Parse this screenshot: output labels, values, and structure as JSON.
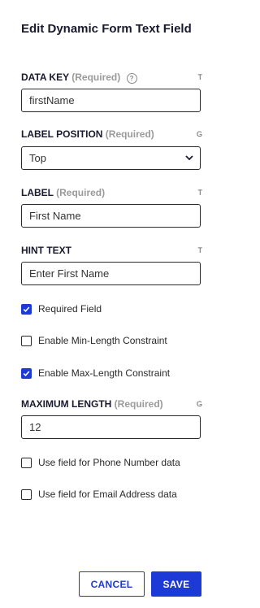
{
  "title": "Edit Dynamic Form Text Field",
  "fields": {
    "data_key": {
      "label": "DATA KEY",
      "required": "(Required)",
      "type_tag": "T",
      "value": "firstName"
    },
    "label_position": {
      "label": "LABEL POSITION",
      "required": "(Required)",
      "type_tag": "G",
      "value": "Top"
    },
    "label": {
      "label": "LABEL",
      "required": "(Required)",
      "type_tag": "T",
      "value": "First Name"
    },
    "hint_text": {
      "label": "HINT TEXT",
      "type_tag": "T",
      "value": "Enter First Name"
    },
    "maximum_length": {
      "label": "MAXIMUM LENGTH",
      "required": "(Required)",
      "type_tag": "G",
      "value": "12"
    }
  },
  "checkboxes": {
    "required_field": {
      "label": "Required Field",
      "checked": true
    },
    "min_length": {
      "label": "Enable Min-Length Constraint",
      "checked": false
    },
    "max_length": {
      "label": "Enable Max-Length Constraint",
      "checked": true
    },
    "phone": {
      "label": "Use field for Phone Number data",
      "checked": false
    },
    "email": {
      "label": "Use field for Email Address data",
      "checked": false
    }
  },
  "buttons": {
    "cancel": "CANCEL",
    "save": "SAVE"
  },
  "colors": {
    "accent": "#1e3ad6",
    "required_text": "#9a9a9a"
  }
}
